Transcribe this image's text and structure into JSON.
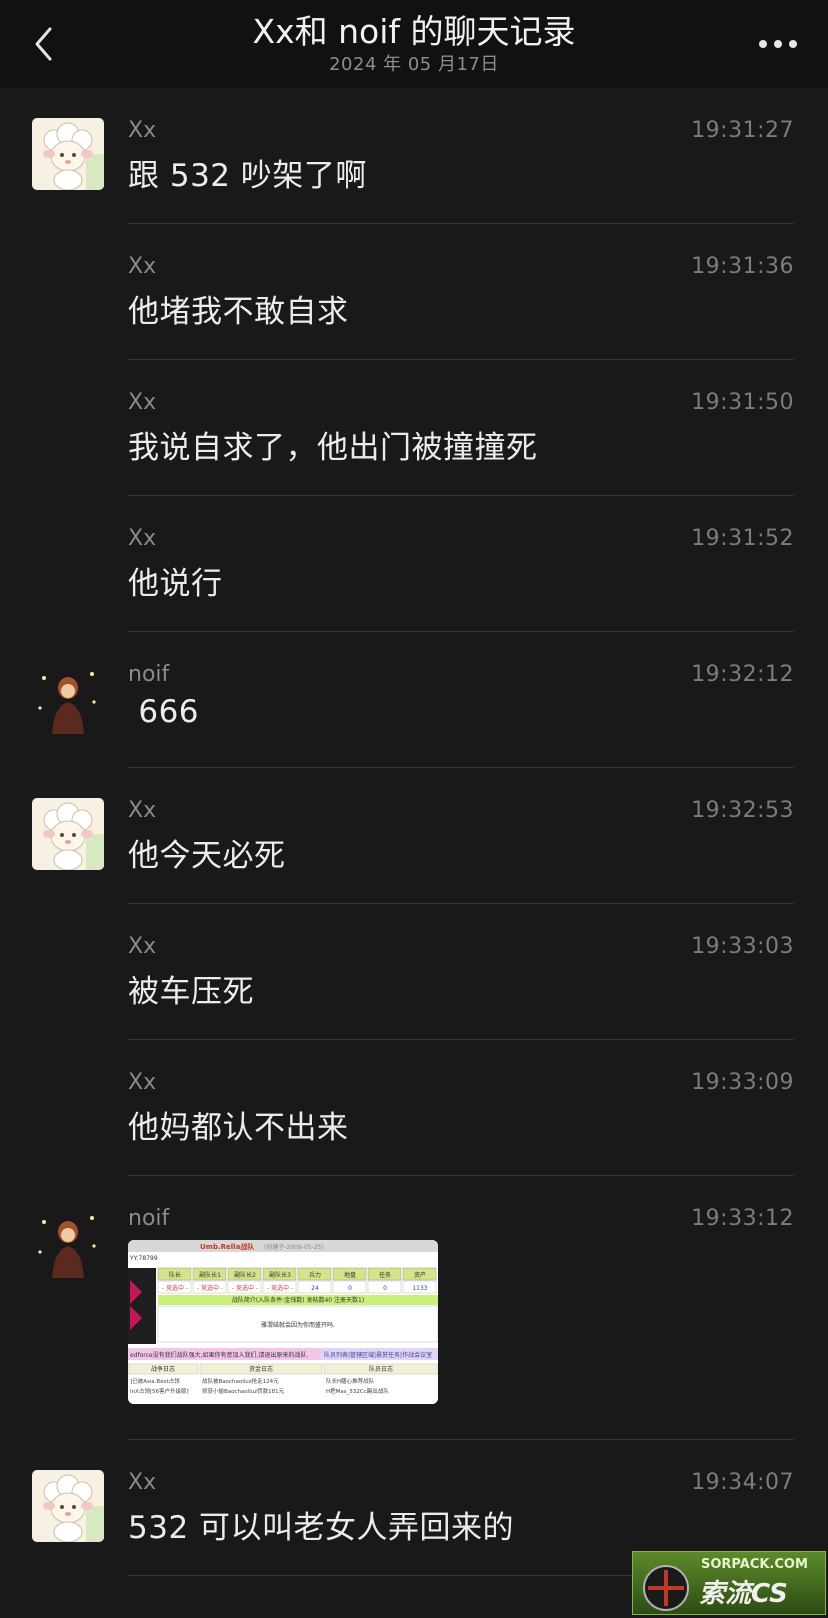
{
  "header": {
    "title": "Xx和 noif 的聊天记录",
    "date": "2024 年 05 月17日",
    "back_icon": "chevron-left-icon",
    "more_icon": "more-dots-icon"
  },
  "messages": [
    {
      "sender": "Xx",
      "time": "19:31:27",
      "text": "跟 532 吵架了啊",
      "avatar": "sheep-avatar"
    },
    {
      "sender": "Xx",
      "time": "19:31:36",
      "text": "他堵我不敢自求",
      "avatar": null
    },
    {
      "sender": "Xx",
      "time": "19:31:50",
      "text": "我说自求了，他出门被撞撞死",
      "avatar": null
    },
    {
      "sender": "Xx",
      "time": "19:31:52",
      "text": "他说行",
      "avatar": null
    },
    {
      "sender": "noif",
      "time": "19:32:12",
      "text": " 666",
      "avatar": "noif-avatar"
    },
    {
      "sender": "Xx",
      "time": "19:32:53",
      "text": "他今天必死",
      "avatar": "sheep-avatar"
    },
    {
      "sender": "Xx",
      "time": "19:33:03",
      "text": "被车压死",
      "avatar": null
    },
    {
      "sender": "Xx",
      "time": "19:33:09",
      "text": "他妈都认不出来",
      "avatar": null
    },
    {
      "sender": "noif",
      "time": "19:33:12",
      "text": "",
      "avatar": "noif-avatar",
      "image": "game-screenshot-thumbnail"
    },
    {
      "sender": "Xx",
      "time": "19:34:07",
      "text": "532 可以叫老女人弄回来的",
      "avatar": "sheep-avatar"
    }
  ],
  "image_thumb": {
    "team": "Umb.Rella战队",
    "created": "(创建于-2009-05-25)",
    "yy": "YY:78799",
    "headers": [
      "队长",
      "副队长1",
      "副队长2",
      "副队长3",
      "兵力",
      "地盘",
      "任务",
      "资产"
    ],
    "row": [
      "- 竞选中 -",
      "- 竞选中 -",
      "- 竞选中 -",
      "- 竞选中 -",
      "24",
      "0",
      "0",
      "1133"
    ],
    "intro": "战队简介(入队条件:金钱数) 发帖数40 注册天数1)",
    "notice": "雅渭结就会因为你而盛开吗.",
    "banner": "edforce没有我们战队强大,如果你有意加入我们,请退出原来的战队.",
    "links": "队员列表|管辖区域|悬赏任务|作战会议室",
    "log_titles": [
      "战争日志",
      "资金日志",
      "队员日志"
    ],
    "log_row1": [
      "]已被Asia.Best占领",
      "战队被Baochaoliuz抢走124元",
      "队长H膳心推荐战队"
    ],
    "log_row2": [
      "InX占领[56客户升级版]",
      "抓获小偷Baochaoliuz罚款181元",
      "H把Mas_532Cc踢出战队"
    ]
  },
  "watermark": {
    "site": "SORPACK.COM",
    "brand": "索流CS"
  },
  "colors": {
    "background": "#191919",
    "header": "#111111",
    "divider": "#343434",
    "text": "#ececec",
    "meta": "#8a8a8a"
  }
}
